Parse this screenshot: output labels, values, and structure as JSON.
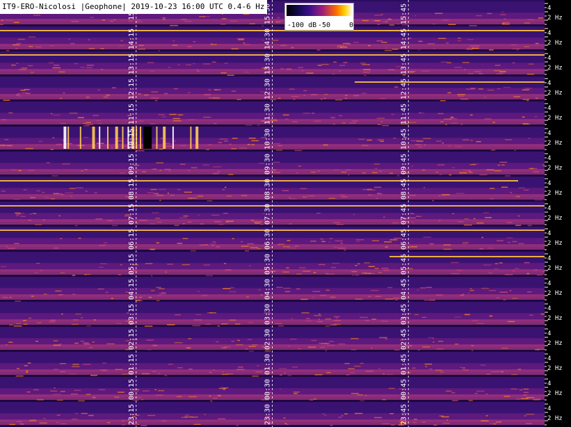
{
  "header": {
    "title": "IT9-ERO-Nicolosi |Geophone| 2019-10-23 16:00 UTC 0.4-6 Hz"
  },
  "colorbar": {
    "labels": [
      "-100 dB",
      "-50",
      "0"
    ],
    "colors": [
      "#000000",
      "#140a50",
      "#3d0f8a",
      "#a0207a",
      "#ff6a00",
      "#ffd000",
      "#ffffff"
    ]
  },
  "chart_data": {
    "type": "heatmap",
    "title": "IT9-ERO-Nicolosi |Geophone| 2019-10-23 16:00 UTC 0.4-6 Hz",
    "colorbar_range_db": [
      -100,
      0
    ],
    "rows": [
      {
        "start": "15:00",
        "labels": [
          "15:",
          "15:30",
          "15:45"
        ]
      },
      {
        "start": "14:00",
        "labels": [
          "14:15",
          "14:30",
          "14:45"
        ]
      },
      {
        "start": "13:00",
        "labels": [
          "13:15",
          "13:30",
          "13:45"
        ]
      },
      {
        "start": "12:00",
        "labels": [
          "12:15",
          "12:30",
          "12:45"
        ]
      },
      {
        "start": "11:00",
        "labels": [
          "11:15",
          "11:30",
          "11:45"
        ]
      },
      {
        "start": "10:00",
        "labels": [
          "10:15",
          "10:30",
          "10:45"
        ]
      },
      {
        "start": "09:00",
        "labels": [
          "09:15",
          "09:30",
          "09:45"
        ]
      },
      {
        "start": "08:00",
        "labels": [
          "08:15",
          "08:30",
          "08:45"
        ]
      },
      {
        "start": "07:00",
        "labels": [
          "07:15",
          "07:30",
          "07:45"
        ]
      },
      {
        "start": "06:00",
        "labels": [
          "06:15",
          "06:30",
          "06:45"
        ]
      },
      {
        "start": "05:00",
        "labels": [
          "05:15",
          "05:30",
          "05:45"
        ]
      },
      {
        "start": "04:00",
        "labels": [
          "04:15",
          "04:30",
          "04:45"
        ]
      },
      {
        "start": "03:00",
        "labels": [
          "03:15",
          "03:30",
          "03:45"
        ]
      },
      {
        "start": "02:00",
        "labels": [
          "02:15",
          "02:30",
          "02:45"
        ]
      },
      {
        "start": "01:00",
        "labels": [
          "01:15",
          "01:30",
          "01:45"
        ]
      },
      {
        "start": "00:00",
        "labels": [
          "00:15",
          "00:30",
          "00:45"
        ]
      },
      {
        "start": "23:00",
        "labels": [
          "23:15",
          "23:30",
          "23:45"
        ]
      }
    ],
    "freq_tick_labels": [
      "4",
      "2 Hz"
    ],
    "events": [
      {
        "row": 5,
        "from_min": 7,
        "to_min": 22,
        "kind": "broadband bursts"
      }
    ]
  }
}
